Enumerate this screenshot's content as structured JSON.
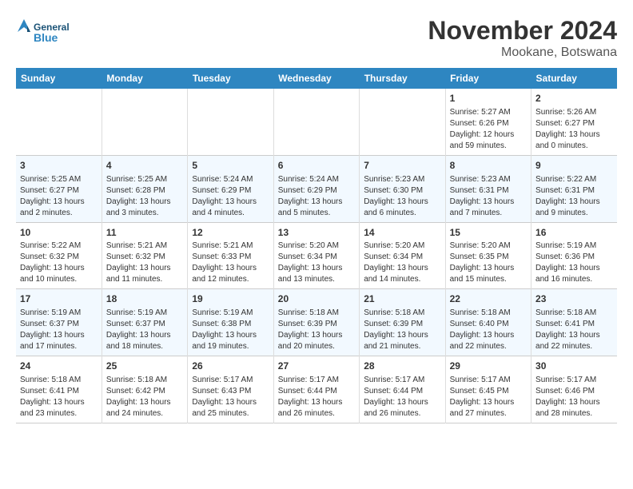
{
  "header": {
    "logo_line1": "General",
    "logo_line2": "Blue",
    "month": "November 2024",
    "location": "Mookane, Botswana"
  },
  "days_of_week": [
    "Sunday",
    "Monday",
    "Tuesday",
    "Wednesday",
    "Thursday",
    "Friday",
    "Saturday"
  ],
  "weeks": [
    [
      {
        "day": "",
        "content": ""
      },
      {
        "day": "",
        "content": ""
      },
      {
        "day": "",
        "content": ""
      },
      {
        "day": "",
        "content": ""
      },
      {
        "day": "",
        "content": ""
      },
      {
        "day": "1",
        "content": "Sunrise: 5:27 AM\nSunset: 6:26 PM\nDaylight: 12 hours and 59 minutes."
      },
      {
        "day": "2",
        "content": "Sunrise: 5:26 AM\nSunset: 6:27 PM\nDaylight: 13 hours and 0 minutes."
      }
    ],
    [
      {
        "day": "3",
        "content": "Sunrise: 5:25 AM\nSunset: 6:27 PM\nDaylight: 13 hours and 2 minutes."
      },
      {
        "day": "4",
        "content": "Sunrise: 5:25 AM\nSunset: 6:28 PM\nDaylight: 13 hours and 3 minutes."
      },
      {
        "day": "5",
        "content": "Sunrise: 5:24 AM\nSunset: 6:29 PM\nDaylight: 13 hours and 4 minutes."
      },
      {
        "day": "6",
        "content": "Sunrise: 5:24 AM\nSunset: 6:29 PM\nDaylight: 13 hours and 5 minutes."
      },
      {
        "day": "7",
        "content": "Sunrise: 5:23 AM\nSunset: 6:30 PM\nDaylight: 13 hours and 6 minutes."
      },
      {
        "day": "8",
        "content": "Sunrise: 5:23 AM\nSunset: 6:31 PM\nDaylight: 13 hours and 7 minutes."
      },
      {
        "day": "9",
        "content": "Sunrise: 5:22 AM\nSunset: 6:31 PM\nDaylight: 13 hours and 9 minutes."
      }
    ],
    [
      {
        "day": "10",
        "content": "Sunrise: 5:22 AM\nSunset: 6:32 PM\nDaylight: 13 hours and 10 minutes."
      },
      {
        "day": "11",
        "content": "Sunrise: 5:21 AM\nSunset: 6:32 PM\nDaylight: 13 hours and 11 minutes."
      },
      {
        "day": "12",
        "content": "Sunrise: 5:21 AM\nSunset: 6:33 PM\nDaylight: 13 hours and 12 minutes."
      },
      {
        "day": "13",
        "content": "Sunrise: 5:20 AM\nSunset: 6:34 PM\nDaylight: 13 hours and 13 minutes."
      },
      {
        "day": "14",
        "content": "Sunrise: 5:20 AM\nSunset: 6:34 PM\nDaylight: 13 hours and 14 minutes."
      },
      {
        "day": "15",
        "content": "Sunrise: 5:20 AM\nSunset: 6:35 PM\nDaylight: 13 hours and 15 minutes."
      },
      {
        "day": "16",
        "content": "Sunrise: 5:19 AM\nSunset: 6:36 PM\nDaylight: 13 hours and 16 minutes."
      }
    ],
    [
      {
        "day": "17",
        "content": "Sunrise: 5:19 AM\nSunset: 6:37 PM\nDaylight: 13 hours and 17 minutes."
      },
      {
        "day": "18",
        "content": "Sunrise: 5:19 AM\nSunset: 6:37 PM\nDaylight: 13 hours and 18 minutes."
      },
      {
        "day": "19",
        "content": "Sunrise: 5:19 AM\nSunset: 6:38 PM\nDaylight: 13 hours and 19 minutes."
      },
      {
        "day": "20",
        "content": "Sunrise: 5:18 AM\nSunset: 6:39 PM\nDaylight: 13 hours and 20 minutes."
      },
      {
        "day": "21",
        "content": "Sunrise: 5:18 AM\nSunset: 6:39 PM\nDaylight: 13 hours and 21 minutes."
      },
      {
        "day": "22",
        "content": "Sunrise: 5:18 AM\nSunset: 6:40 PM\nDaylight: 13 hours and 22 minutes."
      },
      {
        "day": "23",
        "content": "Sunrise: 5:18 AM\nSunset: 6:41 PM\nDaylight: 13 hours and 22 minutes."
      }
    ],
    [
      {
        "day": "24",
        "content": "Sunrise: 5:18 AM\nSunset: 6:41 PM\nDaylight: 13 hours and 23 minutes."
      },
      {
        "day": "25",
        "content": "Sunrise: 5:18 AM\nSunset: 6:42 PM\nDaylight: 13 hours and 24 minutes."
      },
      {
        "day": "26",
        "content": "Sunrise: 5:17 AM\nSunset: 6:43 PM\nDaylight: 13 hours and 25 minutes."
      },
      {
        "day": "27",
        "content": "Sunrise: 5:17 AM\nSunset: 6:44 PM\nDaylight: 13 hours and 26 minutes."
      },
      {
        "day": "28",
        "content": "Sunrise: 5:17 AM\nSunset: 6:44 PM\nDaylight: 13 hours and 26 minutes."
      },
      {
        "day": "29",
        "content": "Sunrise: 5:17 AM\nSunset: 6:45 PM\nDaylight: 13 hours and 27 minutes."
      },
      {
        "day": "30",
        "content": "Sunrise: 5:17 AM\nSunset: 6:46 PM\nDaylight: 13 hours and 28 minutes."
      }
    ]
  ]
}
